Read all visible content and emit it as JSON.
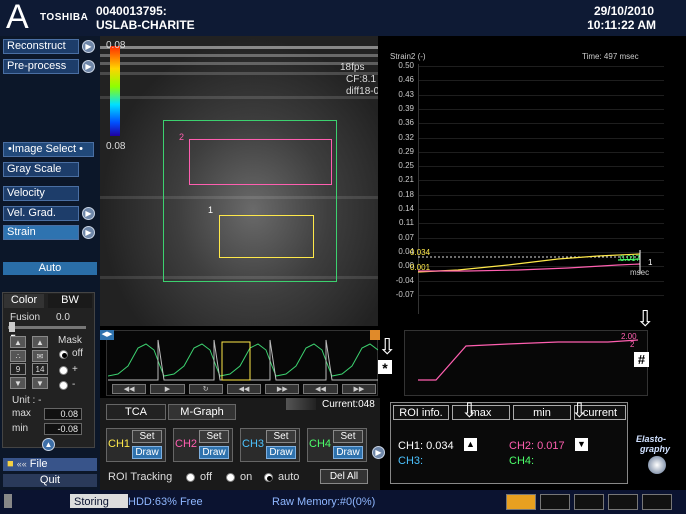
{
  "header": {
    "logo_letter": "A",
    "brand": "TOSHIBA",
    "patient_id": "0040013795:",
    "site": "USLAB-CHARITE",
    "date": "29/10/2010",
    "time": "10:11:22 AM"
  },
  "sidebar": {
    "reconstruct": "Reconstruct",
    "preprocess": "Pre-process",
    "image_select": "Image Select",
    "gray_scale": "Gray Scale",
    "velocity": "Velocity",
    "vel_grad": "Vel. Grad.",
    "strain": "Strain",
    "auto": "Auto",
    "tab_color": "Color",
    "tab_bw": "BW",
    "fusion_label": "Fusion",
    "fusion_value": "0.0",
    "mask_label": "Mask",
    "num_a": "9",
    "num_b": "14",
    "opt_off": "off",
    "opt_plus": "+",
    "opt_minus": "-",
    "unit_label": "Unit : -",
    "max_label": "max",
    "max_value": "0.08",
    "min_label": "min",
    "min_value": "-0.08",
    "file": "File",
    "quit": "Quit"
  },
  "image": {
    "scale_top": "0.08",
    "scale_bottom": "0.08",
    "fps": "18fps",
    "cf": "CF:8.1",
    "diff": "diff18-0",
    "roi_label_1": "1",
    "roi_label_2": "2"
  },
  "graph": {
    "ylabel": "Strain2 (-)",
    "time_label": "Time: 497 msec",
    "yticks": [
      "0.50",
      "0.46",
      "0.43",
      "0.39",
      "0.36",
      "0.32",
      "0.29",
      "0.25",
      "0.21",
      "0.18",
      "0.14",
      "0.11",
      "0.07",
      "0.04",
      "0.00",
      "-0.04",
      "-0.07"
    ],
    "ann_034": "0.034",
    "ann_001": "0.001",
    "ann_017": "0.017",
    "ann_1": "1",
    "xunit": "msec"
  },
  "wave": {
    "current": "Current:048",
    "star": "*",
    "hash": "#",
    "mgraph_label": "2.00",
    "mgraph_marker": "2"
  },
  "bottom": {
    "tab_tca": "TCA",
    "tab_mgraph": "M-Graph",
    "ch1": "CH1",
    "ch2": "CH2",
    "ch3": "CH3",
    "ch4": "CH4",
    "set": "Set",
    "draw": "Draw",
    "roi_tracking": "ROI Tracking",
    "off": "off",
    "on": "on",
    "auto": "auto",
    "del_all": "Del All"
  },
  "roi_info": {
    "tab_info": "ROI info.",
    "tab_max": "max",
    "tab_min": "min",
    "tab_current": "current",
    "ch1": "CH1: 0.034",
    "ch2": "CH2: 0.017",
    "ch3": "CH3:",
    "ch4": "CH4:",
    "logo_line1": "Elasto-",
    "logo_line2": "graphy"
  },
  "status": {
    "storing": "Storing",
    "hdd": "HDD:63% Free",
    "raw_memory": "Raw Memory:#0(0%)"
  },
  "colors": {
    "accent": "#2f72ad",
    "ch1": "#ffe94a",
    "ch2": "#ff5fb0",
    "ch3": "#4cc3ff",
    "ch4": "#4cff6a"
  }
}
